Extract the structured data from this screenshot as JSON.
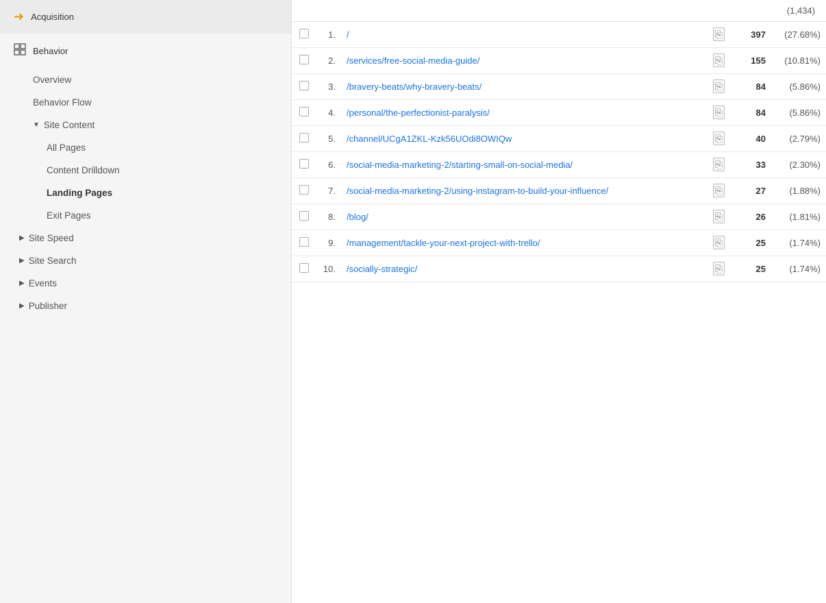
{
  "sidebar": {
    "acquisition": {
      "label": "Acquisition",
      "icon": "arrow-right-icon"
    },
    "behavior": {
      "label": "Behavior",
      "icon": "behavior-icon"
    },
    "overview": {
      "label": "Overview"
    },
    "behavior_flow": {
      "label": "Behavior Flow"
    },
    "site_content": {
      "label": "Site Content",
      "arrow": "▼"
    },
    "all_pages": {
      "label": "All Pages"
    },
    "content_drilldown": {
      "label": "Content Drilldown"
    },
    "landing_pages": {
      "label": "Landing Pages"
    },
    "exit_pages": {
      "label": "Exit Pages"
    },
    "site_speed": {
      "label": "Site Speed",
      "arrow": "▶"
    },
    "site_search": {
      "label": "Site Search",
      "arrow": "▶"
    },
    "events": {
      "label": "Events",
      "arrow": "▶"
    },
    "publisher": {
      "label": "Publisher",
      "arrow": "▶"
    }
  },
  "top_count": "(1,434)",
  "table": {
    "rows": [
      {
        "num": "1.",
        "link": "/",
        "value": "397",
        "pct": "(27.68%)"
      },
      {
        "num": "2.",
        "link": "/services/free-social-media-guide/",
        "value": "155",
        "pct": "(10.81%)"
      },
      {
        "num": "3.",
        "link": "/bravery-beats/why-bravery-beats/",
        "value": "84",
        "pct": "(5.86%)"
      },
      {
        "num": "4.",
        "link": "/personal/the-perfectionist-paralysis/",
        "value": "84",
        "pct": "(5.86%)"
      },
      {
        "num": "5.",
        "link": "/channel/UCgA1ZKL-Kzk56UOdi8OWIQw",
        "value": "40",
        "pct": "(2.79%)"
      },
      {
        "num": "6.",
        "link": "/social-media-marketing-2/starting-small-on-social-media/",
        "value": "33",
        "pct": "(2.30%)"
      },
      {
        "num": "7.",
        "link": "/social-media-marketing-2/using-instagram-to-build-your-influence/",
        "value": "27",
        "pct": "(1.88%)"
      },
      {
        "num": "8.",
        "link": "/blog/",
        "value": "26",
        "pct": "(1.81%)"
      },
      {
        "num": "9.",
        "link": "/management/tackle-your-next-project-with-trello/",
        "value": "25",
        "pct": "(1.74%)"
      },
      {
        "num": "10.",
        "link": "/socially-strategic/",
        "value": "25",
        "pct": "(1.74%)"
      }
    ]
  }
}
